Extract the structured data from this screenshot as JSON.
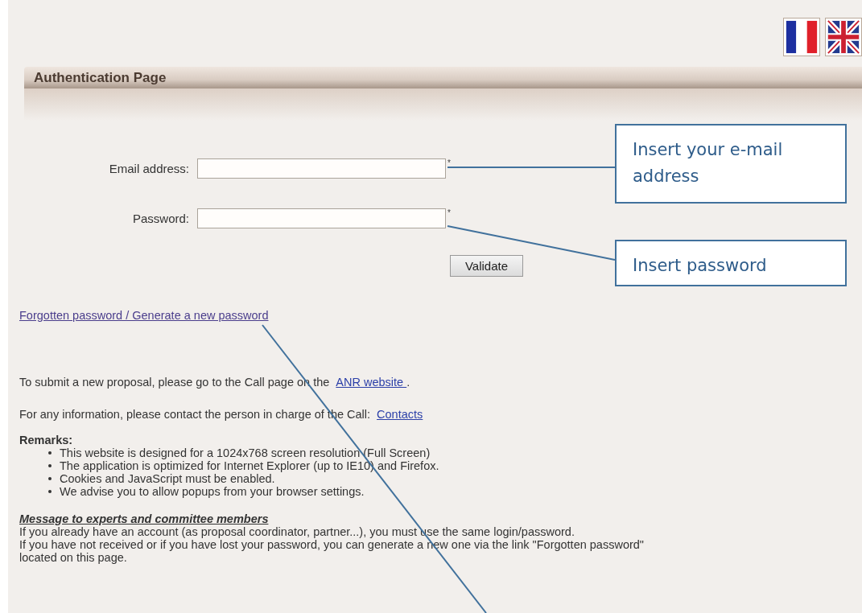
{
  "panel": {
    "title": "Authentication Page"
  },
  "fields": [
    {
      "label": "Email address:",
      "required_mark": "*"
    },
    {
      "label": "Password:",
      "required_mark": "*"
    }
  ],
  "validate_button": "Validate",
  "forgot_link": "Forgotten password / Generate a new password",
  "info": [
    {
      "before": "To submit a new proposal, please go to the Call page on the ",
      "link": "ANR website ",
      "after": "."
    },
    {
      "before": "For any information, please contact the person in charge of the Call: ",
      "link": "Contacts "
    }
  ],
  "remarks": {
    "heading": "Remarks:",
    "items": [
      "This website is designed for a 1024x768 screen resolution (Full Screen)",
      "The application is optimized for Internet Explorer (up to IE10) and Firefox.",
      "Cookies and JavaScript must be enabled.",
      "We advise you to allow popups from your browser settings."
    ]
  },
  "message": {
    "heading": "Message to experts and committee members",
    "lines": [
      "If you already have an account (as proposal coordinator, partner...), you must use the same login/password.",
      "If you have not received or if you have lost your password, you can generate a new one via the link \"Forgotten password\"",
      "located on this page."
    ]
  },
  "callouts": [
    {
      "text": "Insert your e-mail address"
    },
    {
      "text": "Insert password"
    }
  ]
}
